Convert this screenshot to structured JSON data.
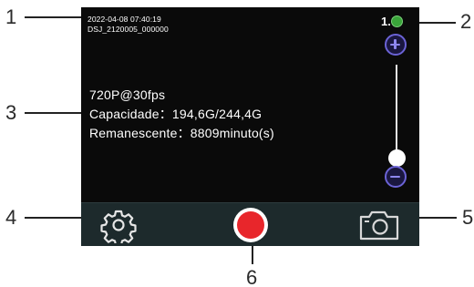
{
  "callouts": [
    "1",
    "2",
    "3",
    "4",
    "5",
    "6"
  ],
  "overlay": {
    "date_time": "2022-04-08  07:40:19",
    "file_name": "DSJ_2120005_000000"
  },
  "zoom": {
    "value": "1.0",
    "level": 0.0
  },
  "recording_info": {
    "resolution": "720P@30fps",
    "capacity": "Capacidade：194,6G/244,4G",
    "remaining": "Remanescente：8809minuto(s)"
  },
  "toolbar": {
    "settings_icon": "gear-icon",
    "record_icon": "record-icon",
    "camera_icon": "camera-icon"
  },
  "colors": {
    "screen_bg": "#0a0a0a",
    "toolbar_bg": "#1d2a2c",
    "record_red": "#e8262b",
    "zoom_accent": "#6b63d6",
    "badge_green": "#3aa53a"
  }
}
